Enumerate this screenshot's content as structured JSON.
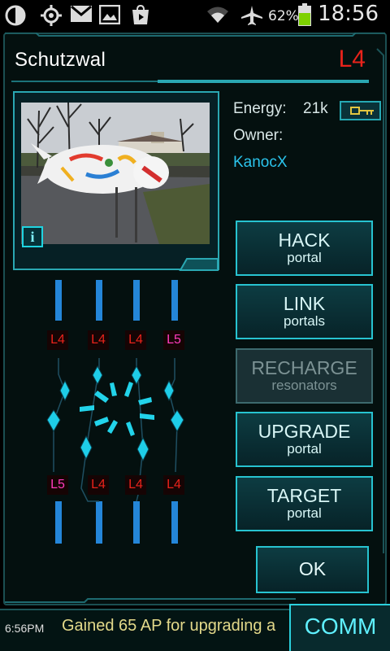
{
  "status_bar": {
    "battery_percent": "62%",
    "time": "18:56",
    "icons": [
      "data-sync-icon",
      "gps-icon",
      "gmail-icon",
      "gallery-icon",
      "play-store-icon",
      "wifi-icon",
      "airplane-mode-icon",
      "battery-icon"
    ]
  },
  "portal": {
    "name": "Schutzwal",
    "level": "L4",
    "energy_label": "Energy:",
    "energy_value": "21k",
    "owner_label": "Owner:",
    "owner_name": "KanocX",
    "info_label": "i"
  },
  "actions": [
    {
      "big": "HACK",
      "small": "portal",
      "enabled": true
    },
    {
      "big": "LINK",
      "small": "portals",
      "enabled": true
    },
    {
      "big": "RECHARGE",
      "small": "resonators",
      "enabled": false
    },
    {
      "big": "UPGRADE",
      "small": "portal",
      "enabled": true
    },
    {
      "big": "TARGET",
      "small": "portal",
      "enabled": true
    }
  ],
  "ok_label": "OK",
  "resonators": {
    "top": [
      "L4",
      "L4",
      "L4",
      "L5"
    ],
    "bottom": [
      "L5",
      "L4",
      "L4",
      "L4"
    ]
  },
  "bottom_bar": {
    "time": "6:56PM",
    "message": "Gained 65 AP for upgrading a",
    "comm_label": "COMM"
  },
  "colors": {
    "accent": "#27c3d0",
    "level_red": "#e8231b",
    "level_magenta": "#ff3bbd",
    "owner_blue": "#2bc4ec",
    "message_yellow": "#e3d98a"
  }
}
